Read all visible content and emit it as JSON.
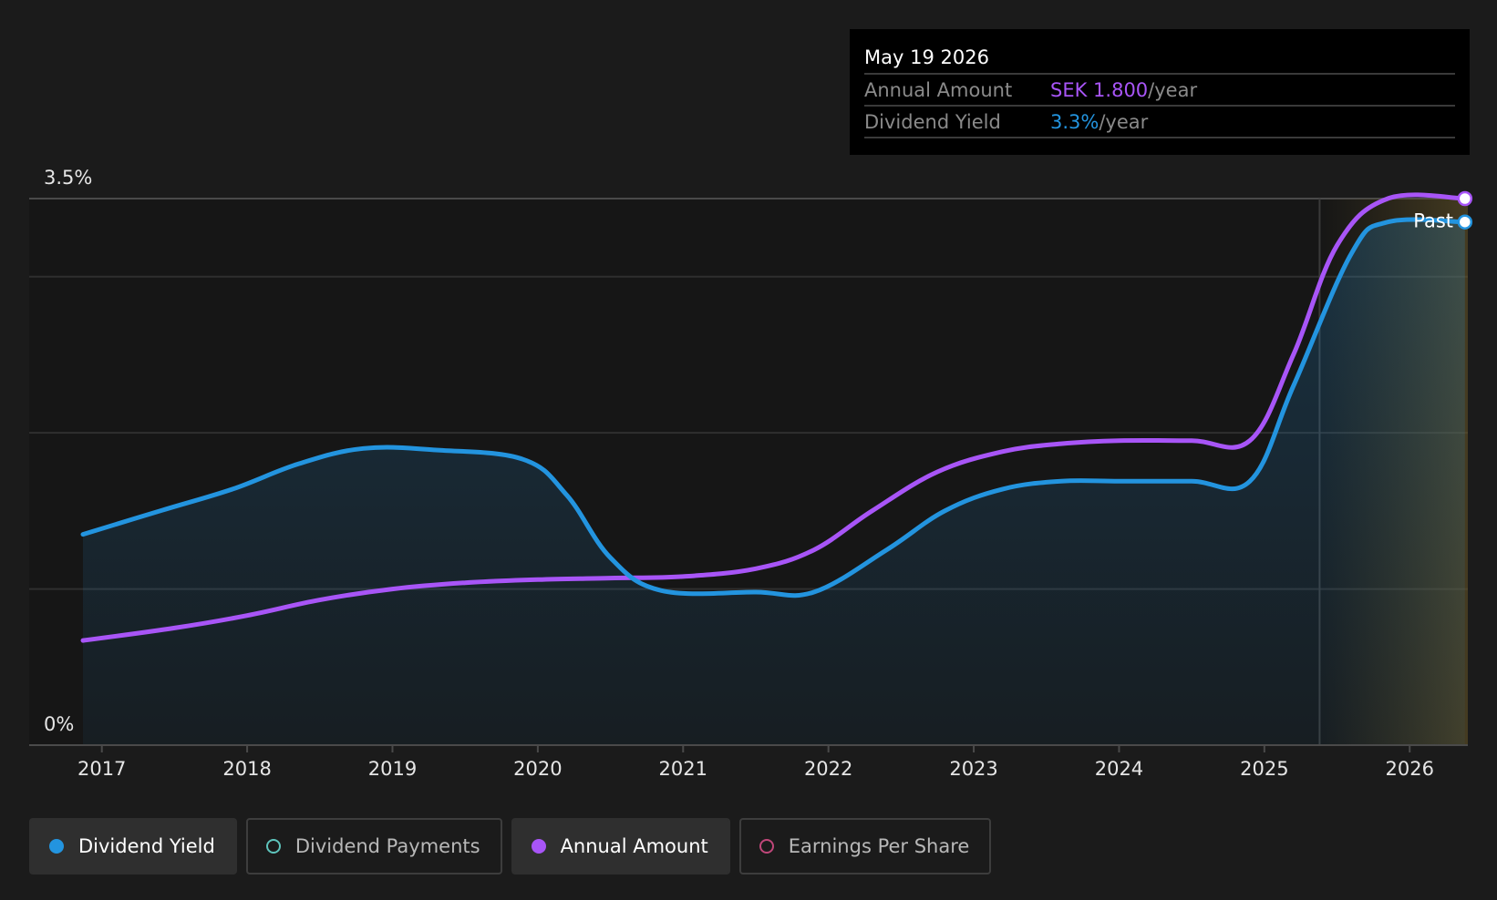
{
  "tooltip": {
    "date": "May 19 2026",
    "annual_label": "Annual Amount",
    "annual_value": "SEK 1.800",
    "annual_unit": "/year",
    "yield_label": "Dividend Yield",
    "yield_value": "3.3%",
    "yield_unit": "/year"
  },
  "legend": [
    {
      "label": "Dividend Yield",
      "color": "#2394df",
      "filled": true,
      "active": true
    },
    {
      "label": "Dividend Payments",
      "color": "#5ec4bc",
      "filled": false,
      "active": false
    },
    {
      "label": "Annual Amount",
      "color": "#a855f7",
      "filled": true,
      "active": true
    },
    {
      "label": "Earnings Per Share",
      "color": "#c0477a",
      "filled": false,
      "active": false
    }
  ],
  "colors": {
    "yield": "#2394df",
    "annual": "#a855f7",
    "background": "#1b1b1b",
    "plot_background": "#161616"
  },
  "chart_data": {
    "type": "line",
    "xlim": [
      2016.5,
      2026.4
    ],
    "ylim": [
      0,
      3.5
    ],
    "y_tick_labels": [
      {
        "value": 3.5,
        "label": "3.5%"
      },
      {
        "value": 0,
        "label": "0%"
      }
    ],
    "gridlines": [
      0,
      1,
      2,
      3,
      3.5
    ],
    "x_ticks": [
      2017,
      2018,
      2019,
      2020,
      2021,
      2022,
      2023,
      2024,
      2025,
      2026
    ],
    "past_label": "Past",
    "past_start": 2025.38,
    "series": [
      {
        "name": "Dividend Yield",
        "color": "#2394df",
        "fill": true,
        "points": [
          [
            2016.87,
            1.35
          ],
          [
            2017.4,
            1.5
          ],
          [
            2017.9,
            1.64
          ],
          [
            2018.35,
            1.8
          ],
          [
            2018.8,
            1.9
          ],
          [
            2019.3,
            1.89
          ],
          [
            2019.9,
            1.83
          ],
          [
            2020.2,
            1.6
          ],
          [
            2020.5,
            1.2
          ],
          [
            2020.85,
            0.99
          ],
          [
            2021.5,
            0.98
          ],
          [
            2021.9,
            0.98
          ],
          [
            2022.4,
            1.25
          ],
          [
            2022.8,
            1.5
          ],
          [
            2023.2,
            1.64
          ],
          [
            2023.6,
            1.69
          ],
          [
            2024.0,
            1.69
          ],
          [
            2024.5,
            1.69
          ],
          [
            2024.9,
            1.69
          ],
          [
            2025.2,
            2.3
          ],
          [
            2025.6,
            3.15
          ],
          [
            2025.85,
            3.35
          ],
          [
            2026.38,
            3.35
          ]
        ]
      },
      {
        "name": "Annual Amount",
        "color": "#a855f7",
        "fill": false,
        "points": [
          [
            2016.87,
            0.67
          ],
          [
            2017.5,
            0.75
          ],
          [
            2018.0,
            0.83
          ],
          [
            2018.5,
            0.93
          ],
          [
            2019.0,
            1.0
          ],
          [
            2019.5,
            1.04
          ],
          [
            2020.0,
            1.06
          ],
          [
            2020.5,
            1.07
          ],
          [
            2021.0,
            1.08
          ],
          [
            2021.5,
            1.13
          ],
          [
            2021.9,
            1.25
          ],
          [
            2022.3,
            1.5
          ],
          [
            2022.75,
            1.75
          ],
          [
            2023.2,
            1.88
          ],
          [
            2023.6,
            1.93
          ],
          [
            2024.0,
            1.95
          ],
          [
            2024.5,
            1.95
          ],
          [
            2024.9,
            1.95
          ],
          [
            2025.2,
            2.5
          ],
          [
            2025.5,
            3.2
          ],
          [
            2025.85,
            3.5
          ],
          [
            2026.38,
            3.5
          ]
        ]
      }
    ]
  }
}
